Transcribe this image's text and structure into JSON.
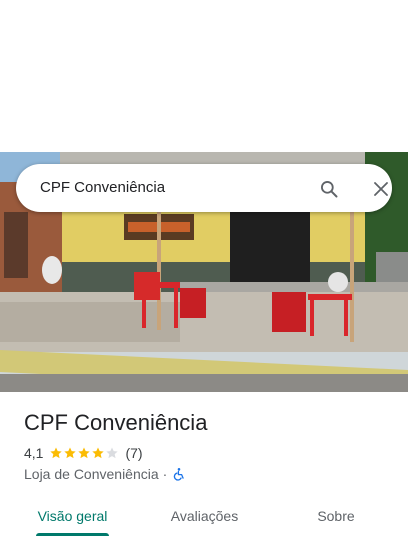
{
  "search": {
    "query": "CPF Conveniência"
  },
  "place": {
    "title": "CPF Conveniência",
    "rating": "4,1",
    "stars": 4.1,
    "review_count": "(7)",
    "category": "Loja de Conveniência",
    "separator": "·",
    "accessibility_icon": "wheelchair-icon"
  },
  "tabs": [
    {
      "label": "Visão geral",
      "active": true
    },
    {
      "label": "Avaliações",
      "active": false
    },
    {
      "label": "Sobre",
      "active": false
    }
  ],
  "colors": {
    "accent": "#00796b",
    "star": "#fbbc04",
    "star_empty": "#dadce0",
    "accessibility": "#1a73e8"
  }
}
